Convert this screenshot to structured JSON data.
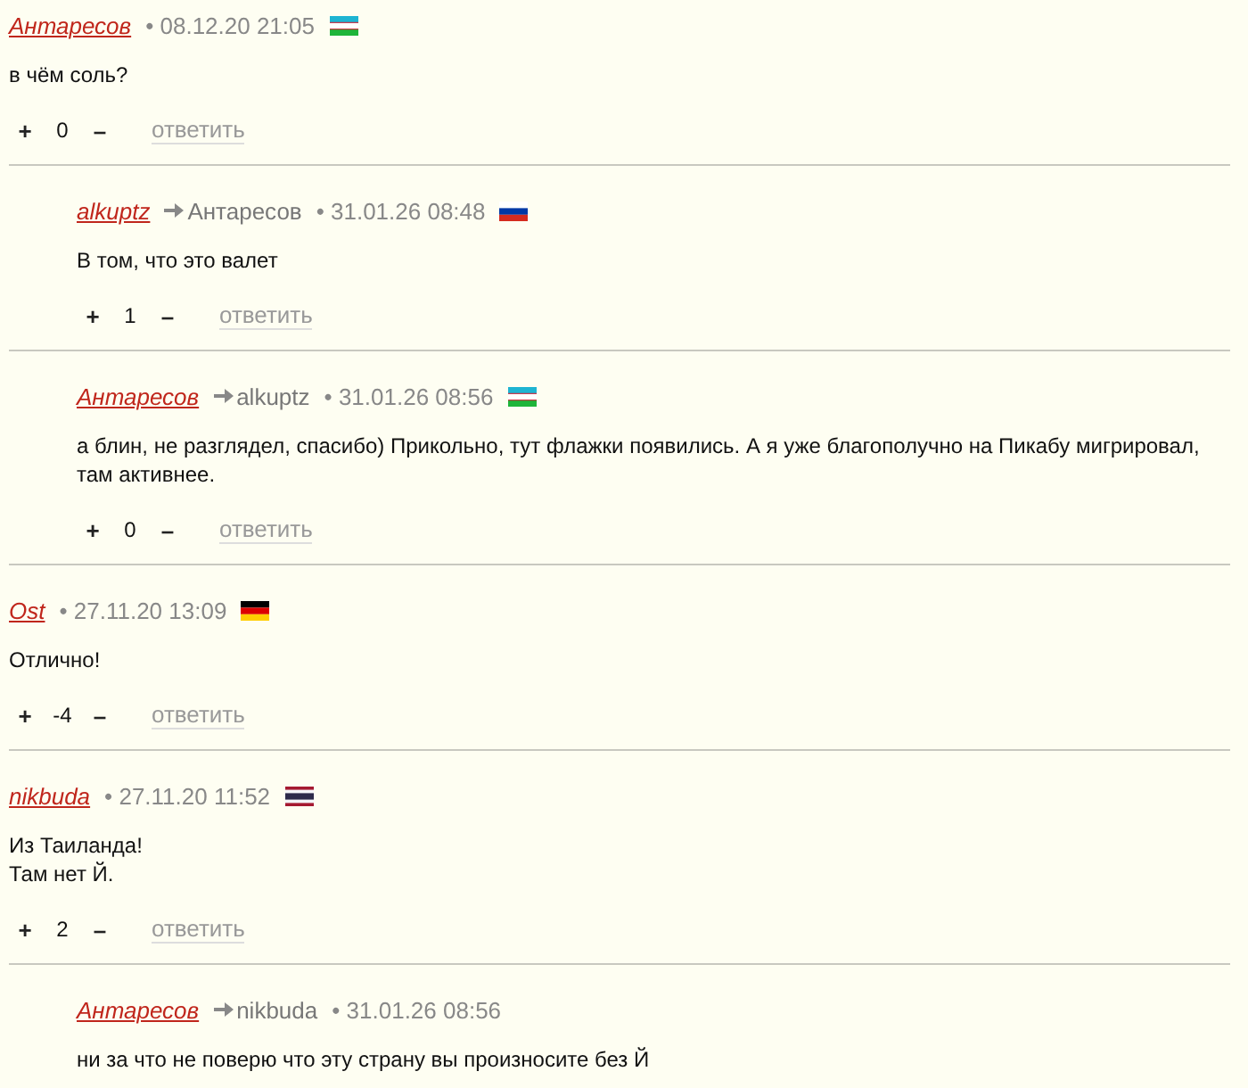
{
  "comments": [
    {
      "author": "Антаресов",
      "time": "• 08.12.20 21:05",
      "flag": {
        "kind": "uz"
      },
      "text": [
        "в чём соль?"
      ],
      "plus": "+",
      "score": "0",
      "minus": "–",
      "reply": "ответить",
      "children": [
        {
          "author": "alkuptz",
          "reply_to": "Антаресов",
          "time": "• 31.01.26 08:48",
          "flag": {
            "kind": "ru"
          },
          "text": [
            "В том, что это валет"
          ],
          "plus": "+",
          "score": "1",
          "minus": "–",
          "reply": "ответить"
        },
        {
          "author": "Антаресов",
          "reply_to": "alkuptz",
          "time": "• 31.01.26 08:56",
          "flag": {
            "kind": "uz"
          },
          "text": [
            "а блин, не разглядел, спасибо) Прикольно, тут флажки появились. А я уже благополучно на Пикабу мигрировал, там активнее."
          ],
          "plus": "+",
          "score": "0",
          "minus": "–",
          "reply": "ответить"
        }
      ]
    },
    {
      "author": "Ost",
      "time": "• 27.11.20 13:09",
      "flag": {
        "kind": "de"
      },
      "text": [
        "Отлично!"
      ],
      "plus": "+",
      "score": "-4",
      "minus": "–",
      "reply": "ответить"
    },
    {
      "author": "nikbuda",
      "time": "• 27.11.20 11:52",
      "flag": {
        "kind": "th"
      },
      "text": [
        "Из Таиланда!",
        "Там нет Й."
      ],
      "plus": "+",
      "score": "2",
      "minus": "–",
      "reply": "ответить",
      "children": [
        {
          "author": "Антаресов",
          "reply_to": "nikbuda",
          "time": "• 31.01.26 08:56",
          "text": [
            "ни за что не поверю что эту страну вы произносите без Й"
          ]
        }
      ]
    }
  ]
}
